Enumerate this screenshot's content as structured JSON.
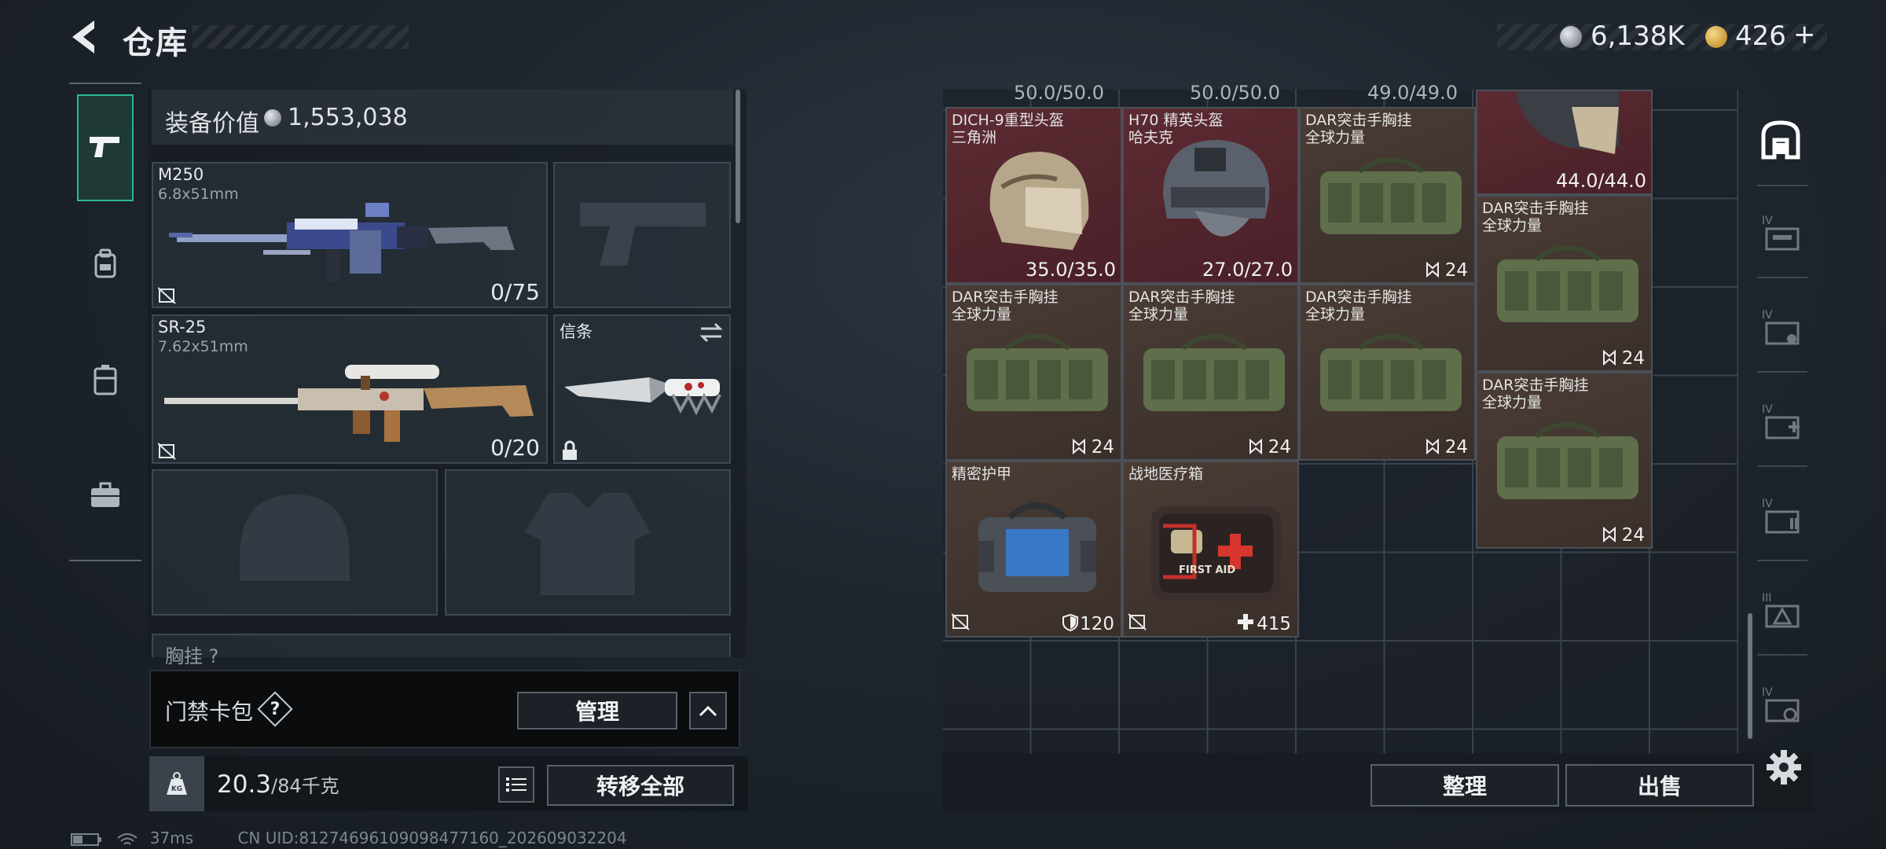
{
  "header": {
    "title": "仓库",
    "currency_silver": "6,138K",
    "currency_gold": "426",
    "add_label": "+"
  },
  "sidebar_tabs": [
    {
      "name": "tab-weapons",
      "icon": "pistol-icon",
      "active": true
    },
    {
      "name": "tab-backpack",
      "icon": "backpack-icon",
      "active": false
    },
    {
      "name": "tab-container",
      "icon": "container-icon",
      "active": false
    },
    {
      "name": "tab-case",
      "icon": "briefcase-icon",
      "active": false
    }
  ],
  "equipment": {
    "value_label": "装备价值",
    "value": "1,553,038",
    "primary": {
      "name": "M250",
      "caliber": "6.8x51mm",
      "ammo": "0/75"
    },
    "secondary": {
      "name": "SR-25",
      "caliber": "7.62x51mm",
      "ammo": "0/20"
    },
    "melee": {
      "name": "信条"
    },
    "chest_label": "胸挂",
    "chest_help": "?"
  },
  "wallet": {
    "label": "门禁卡包",
    "help": "?",
    "manage_label": "管理"
  },
  "weight": {
    "kg_label": "KG",
    "current": "20.3",
    "max": "/84千克",
    "transfer_all_label": "转移全部"
  },
  "status": {
    "ping": "37ms",
    "uid": "CN UID:81274696109098477160_202609032204"
  },
  "inventory": {
    "top_partial": [
      "50.0/50.0",
      "50.0/50.0",
      "49.0/49.0"
    ],
    "items": [
      {
        "name": "DICH-9重型头盔",
        "sub": "三角洲",
        "value": "35.0/35.0"
      },
      {
        "name": "H70 精英头盔",
        "sub": "哈夫克",
        "value": "27.0/27.0"
      },
      {
        "name": "DAR突击手胸挂",
        "sub": "全球力量",
        "capacity": "24"
      },
      {
        "name": "",
        "sub": "",
        "value": "44.0/44.0"
      },
      {
        "name": "DAR突击手胸挂",
        "sub": "全球力量",
        "capacity": "24"
      },
      {
        "name": "DAR突击手胸挂",
        "sub": "全球力量",
        "capacity": "24"
      },
      {
        "name": "DAR突击手胸挂",
        "sub": "全球力量",
        "capacity": "24"
      },
      {
        "name": "DAR突击手胸挂",
        "sub": "全球力量",
        "capacity": "24"
      },
      {
        "name": "DAR突击手胸挂",
        "sub": "全球力量",
        "capacity": "24"
      },
      {
        "name": "精密护甲",
        "sub": "",
        "value": "120"
      },
      {
        "name": "战地医疗箱",
        "sub": "",
        "value": "415",
        "kit_text": "FIRST AID"
      }
    ],
    "sort_label": "整理",
    "sell_label": "出售"
  },
  "side_icons": [
    "storage-icon",
    "stash-weapons-icon",
    "stash-keys-icon",
    "stash-medical-icon",
    "stash-ammo-icon",
    "stash-gear-icon",
    "stash-special-icon",
    "settings-icon"
  ],
  "side_icon_levels": [
    "IV",
    "IV",
    "IV",
    "IV",
    "III",
    "IV"
  ]
}
